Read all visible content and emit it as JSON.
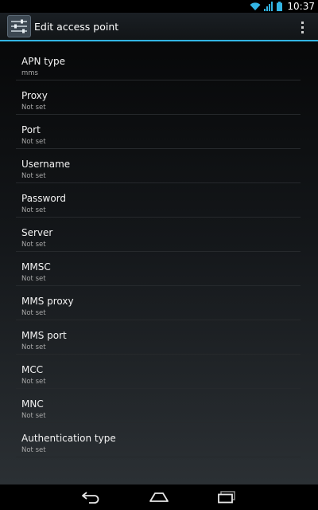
{
  "status_bar": {
    "time": "10:37",
    "icons": [
      "wifi-icon",
      "signal-icon",
      "battery-icon"
    ]
  },
  "action_bar": {
    "title": "Edit access point",
    "icon": "settings-sliders-icon",
    "overflow_icon": "overflow-menu-icon"
  },
  "preferences": [
    {
      "title": "APN type",
      "summary": "mms"
    },
    {
      "title": "Proxy",
      "summary": "Not set"
    },
    {
      "title": "Port",
      "summary": "Not set"
    },
    {
      "title": "Username",
      "summary": "Not set"
    },
    {
      "title": "Password",
      "summary": "Not set"
    },
    {
      "title": "Server",
      "summary": "Not set"
    },
    {
      "title": "MMSC",
      "summary": "Not set"
    },
    {
      "title": "MMS proxy",
      "summary": "Not set"
    },
    {
      "title": "MMS port",
      "summary": "Not set"
    },
    {
      "title": "MCC",
      "summary": "Not set"
    },
    {
      "title": "MNC",
      "summary": "Not set"
    },
    {
      "title": "Authentication type",
      "summary": "Not set"
    }
  ],
  "nav_bar": {
    "buttons": [
      "back-icon",
      "home-icon",
      "recent-apps-icon"
    ]
  },
  "colors": {
    "accent": "#33b5e5",
    "background": "#000000",
    "divider": "#26292c",
    "summary_text": "#a8a8a8"
  }
}
